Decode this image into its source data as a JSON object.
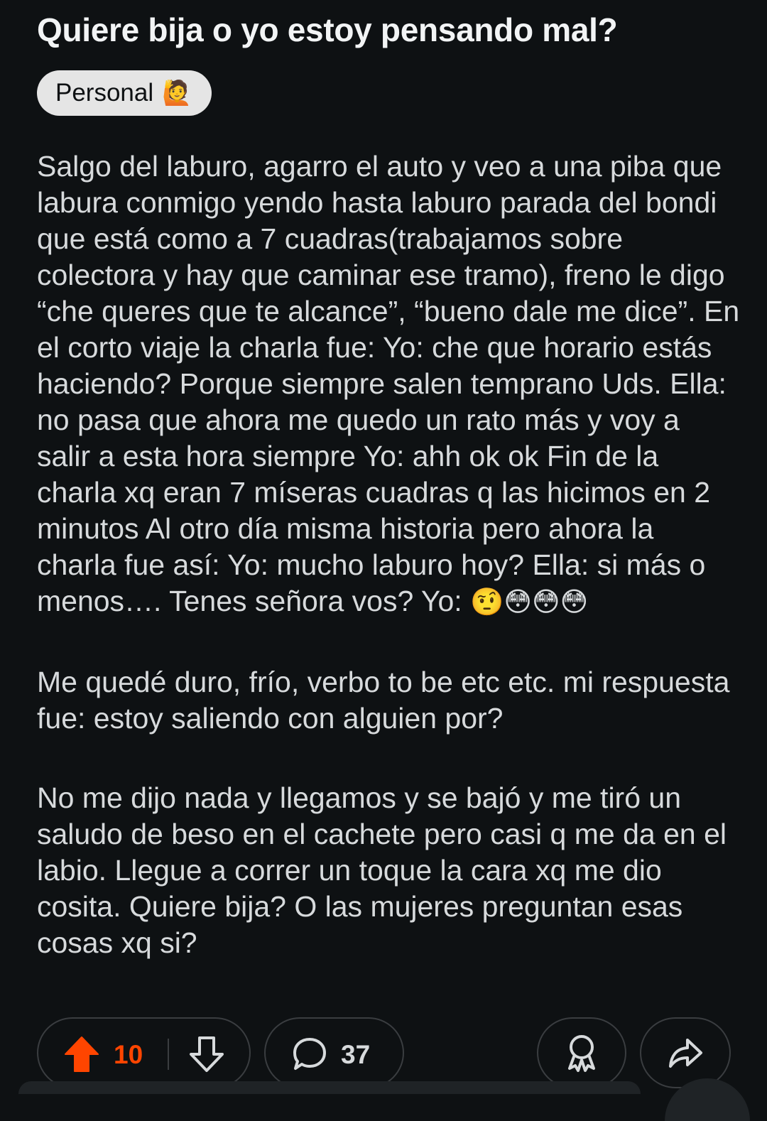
{
  "post": {
    "title": "Quiere bija o yo estoy pensando mal?",
    "flair": {
      "label": "Personal",
      "emoji": "🙋"
    },
    "body": {
      "p1": "Salgo del laburo, agarro el auto y veo a una piba que labura conmigo yendo hasta laburo parada del bondi que está como a 7 cuadras(trabajamos sobre colectora y hay que caminar ese tramo), freno le digo “che queres que te alcance”, “bueno dale me dice”. En el corto viaje la charla fue: Yo: che que horario estás haciendo? Porque siempre salen temprano Uds. Ella: no pasa que ahora me quedo un rato más y voy a salir a esta hora siempre Yo: ahh ok ok Fin de la charla xq eran 7 míseras cuadras q las hicimos en 2 minutos Al otro día misma historia pero ahora la charla fue así: Yo: mucho laburo hoy? Ella: si más o menos…. Tenes señora vos? Yo:",
      "p1_emojis": "🤨😳😳😳",
      "p2": "Me quedé duro, frío, verbo to be etc etc. mi respuesta fue: estoy saliendo con alguien por?",
      "p3": "No me dijo nada y llegamos y se bajó y me tiró un saludo de beso en el cachete pero casi q me da en el labio. Llegue a correr un toque la cara xq me dio cosita. Quiere bija? O las mujeres preguntan esas cosas xq si?"
    }
  },
  "actions": {
    "votes": "10",
    "comments": "37",
    "upvote_icon": "arrow-up-icon",
    "downvote_icon": "arrow-down-icon",
    "comment_icon": "speech-bubble-icon",
    "award_icon": "award-ribbon-icon",
    "share_icon": "share-arrow-icon",
    "upvoted": true
  },
  "colors": {
    "background": "#0e1113",
    "text": "#d7dadc",
    "title": "#f2f4f5",
    "accent_upvote": "#ff4500",
    "flair_bg": "#e5e5e5",
    "pill_border": "#3a3d40"
  }
}
